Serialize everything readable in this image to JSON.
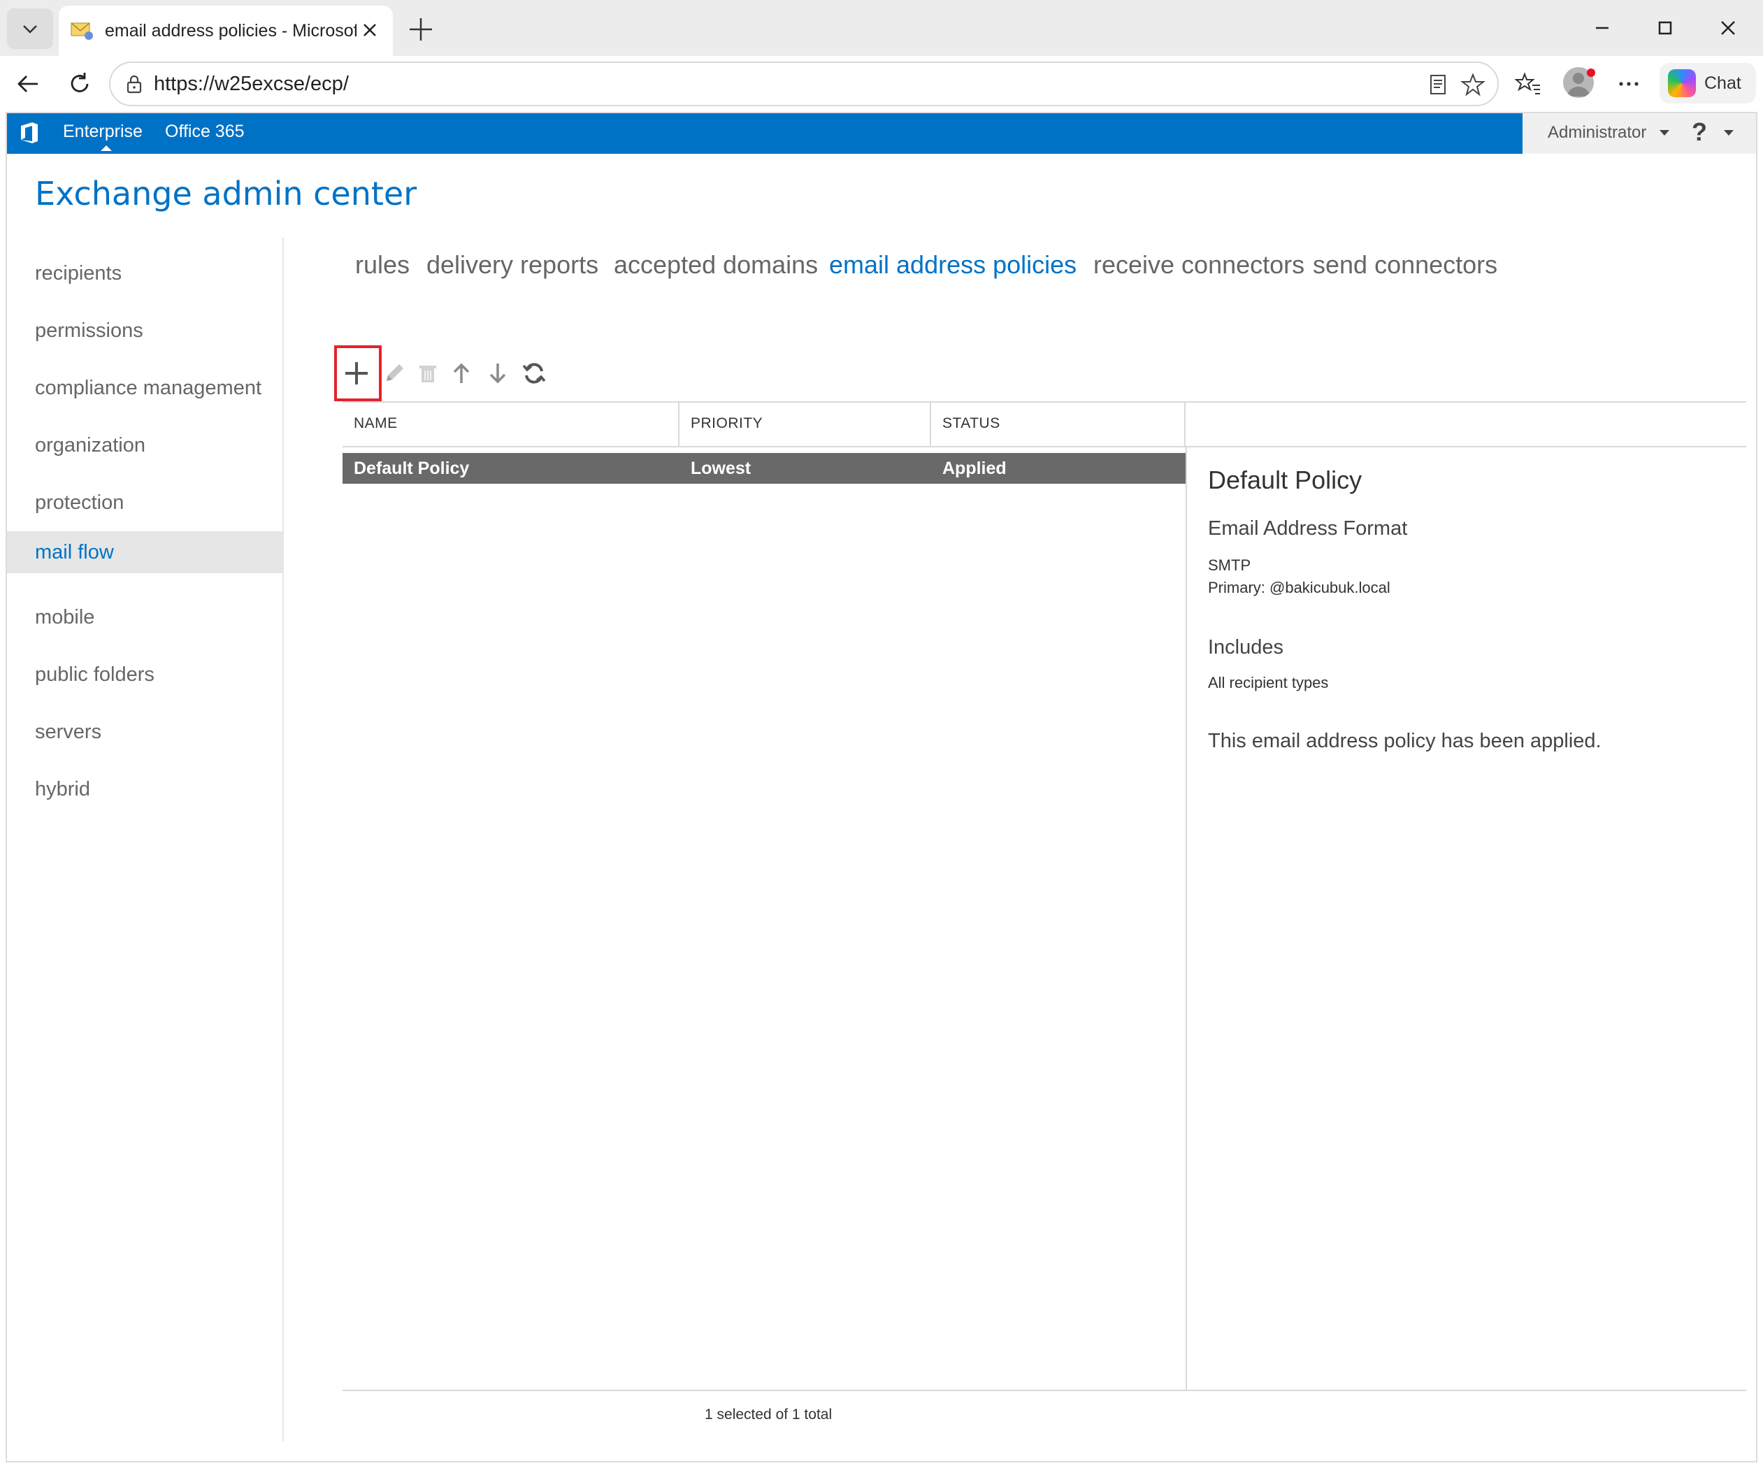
{
  "browser": {
    "tab_title": "email address policies - Microsoft Exchange",
    "url": "https://w25excse/ecp/",
    "chat_label": "Chat"
  },
  "topbar": {
    "links": [
      "Enterprise",
      "Office 365"
    ],
    "user": "Administrator",
    "help": "?",
    "color": "#0072c6"
  },
  "app": {
    "title": "Exchange admin center"
  },
  "left_nav": {
    "items": [
      "recipients",
      "permissions",
      "compliance management",
      "organization",
      "protection",
      "mail flow",
      "mobile",
      "public folders",
      "servers",
      "hybrid"
    ],
    "active": "mail flow"
  },
  "tabs": {
    "items": [
      "rules",
      "delivery reports",
      "accepted domains",
      "email address policies",
      "receive connectors",
      "send connectors"
    ],
    "active": "email address policies"
  },
  "toolbar": {
    "icons": [
      "add-icon",
      "edit-icon",
      "delete-icon",
      "move-up-icon",
      "move-down-icon",
      "refresh-icon"
    ]
  },
  "list": {
    "columns": [
      "NAME",
      "PRIORITY",
      "STATUS"
    ],
    "rows": [
      {
        "name": "Default Policy",
        "priority": "Lowest",
        "status": "Applied"
      }
    ],
    "footer": "1 selected of 1 total"
  },
  "details": {
    "title": "Default Policy",
    "format_heading": "Email Address Format",
    "format_type": "SMTP",
    "format_value": "Primary: @bakicubuk.local",
    "includes_heading": "Includes",
    "includes_value": "All recipient types",
    "message": "This email address policy has been applied."
  }
}
